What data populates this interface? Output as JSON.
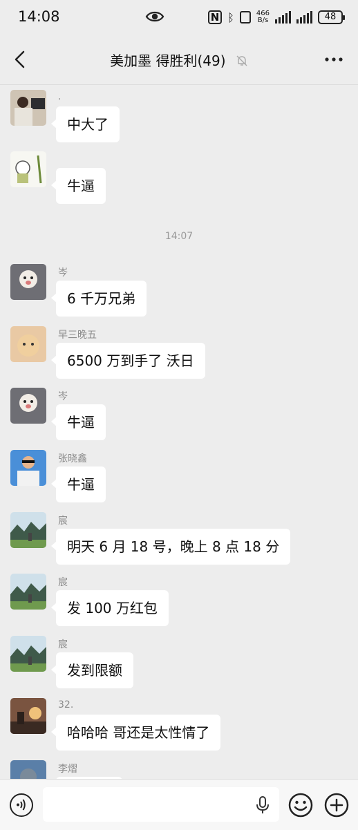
{
  "status_bar": {
    "time": "14:08",
    "net_speed_top": "466",
    "net_speed_unit": "B/s",
    "battery": "48"
  },
  "nav": {
    "title": "美加墨 得胜利(49)",
    "back_icon": "chevron-left-icon",
    "mute_icon": "bell-off-icon",
    "more_icon": "more-dots-icon"
  },
  "chat": {
    "messages": [
      {
        "sender": ".",
        "text": "中大了"
      },
      {
        "sender": "",
        "text": "牛逼"
      },
      {
        "sender": "岑",
        "text": "6 千万兄弟"
      },
      {
        "sender": "早三晚五",
        "text": "6500 万到手了 沃日"
      },
      {
        "sender": "岑",
        "text": "牛逼"
      },
      {
        "sender": "张晓鑫",
        "text": "牛逼"
      },
      {
        "sender": "宸",
        "text": "明天 6 月 18 号，晚上 8 点 18 分"
      },
      {
        "sender": "宸",
        "text": "发 100 万红包"
      },
      {
        "sender": "宸",
        "text": "发到限额"
      },
      {
        "sender": "32.",
        "text": "哈哈哈 哥还是太性情了"
      },
      {
        "sender": "李熠",
        "text": ""
      }
    ],
    "time_separator": "14:07"
  },
  "input_bar": {
    "placeholder": "",
    "voice_icon": "voice-wave-icon",
    "mic_icon": "microphone-icon",
    "emoji_icon": "smiley-icon",
    "plus_icon": "plus-circle-icon"
  }
}
